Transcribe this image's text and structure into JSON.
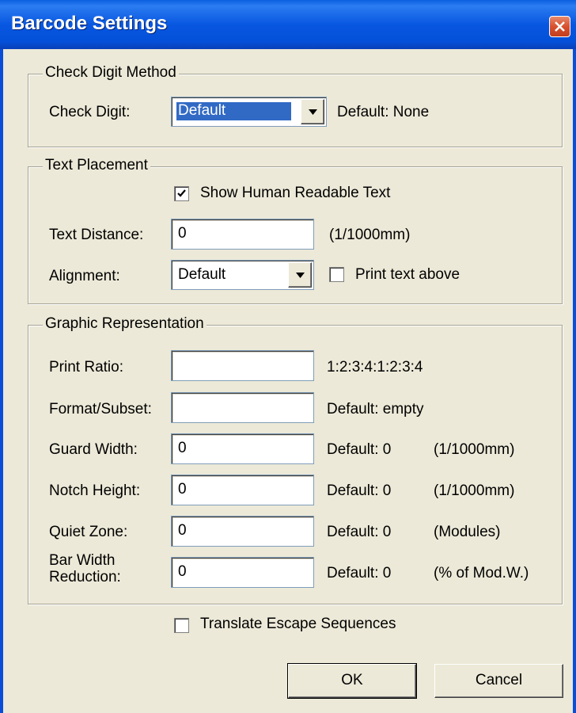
{
  "window": {
    "title": "Barcode Settings",
    "close_icon": "close-icon",
    "accent_color": "#0A4ED8"
  },
  "check_digit_method": {
    "legend": "Check Digit Method",
    "check_digit_label": "Check Digit:",
    "check_digit_value": "Default",
    "check_digit_default": "Default: None"
  },
  "text_placement": {
    "legend": "Text Placement",
    "show_human_readable_label": "Show Human Readable Text",
    "show_human_readable_checked": true,
    "text_distance_label": "Text Distance:",
    "text_distance_value": "0",
    "text_distance_unit": "(1/1000mm)",
    "alignment_label": "Alignment:",
    "alignment_value": "Default",
    "print_text_above_label": "Print text above",
    "print_text_above_checked": false
  },
  "graphic_representation": {
    "legend": "Graphic Representation",
    "print_ratio_label": "Print Ratio:",
    "print_ratio_value": "",
    "print_ratio_hint": "1:2:3:4:1:2:3:4",
    "format_subset_label": "Format/Subset:",
    "format_subset_value": "",
    "format_subset_default": "Default: empty",
    "guard_width_label": "Guard Width:",
    "guard_width_value": "0",
    "guard_width_default": "Default: 0",
    "guard_width_unit": "(1/1000mm)",
    "notch_height_label": "Notch Height:",
    "notch_height_value": "0",
    "notch_height_default": "Default: 0",
    "notch_height_unit": "(1/1000mm)",
    "quiet_zone_label": "Quiet Zone:",
    "quiet_zone_value": "0",
    "quiet_zone_default": "Default: 0",
    "quiet_zone_unit": "(Modules)",
    "bar_width_reduction_label_line1": "Bar Width",
    "bar_width_reduction_label_line2": "Reduction:",
    "bar_width_reduction_value": "0",
    "bar_width_reduction_default": "Default: 0",
    "bar_width_reduction_unit": "(% of Mod.W.)"
  },
  "translate_escape": {
    "label": "Translate Escape Sequences",
    "checked": false
  },
  "buttons": {
    "ok_label": "OK",
    "cancel_label": "Cancel"
  }
}
